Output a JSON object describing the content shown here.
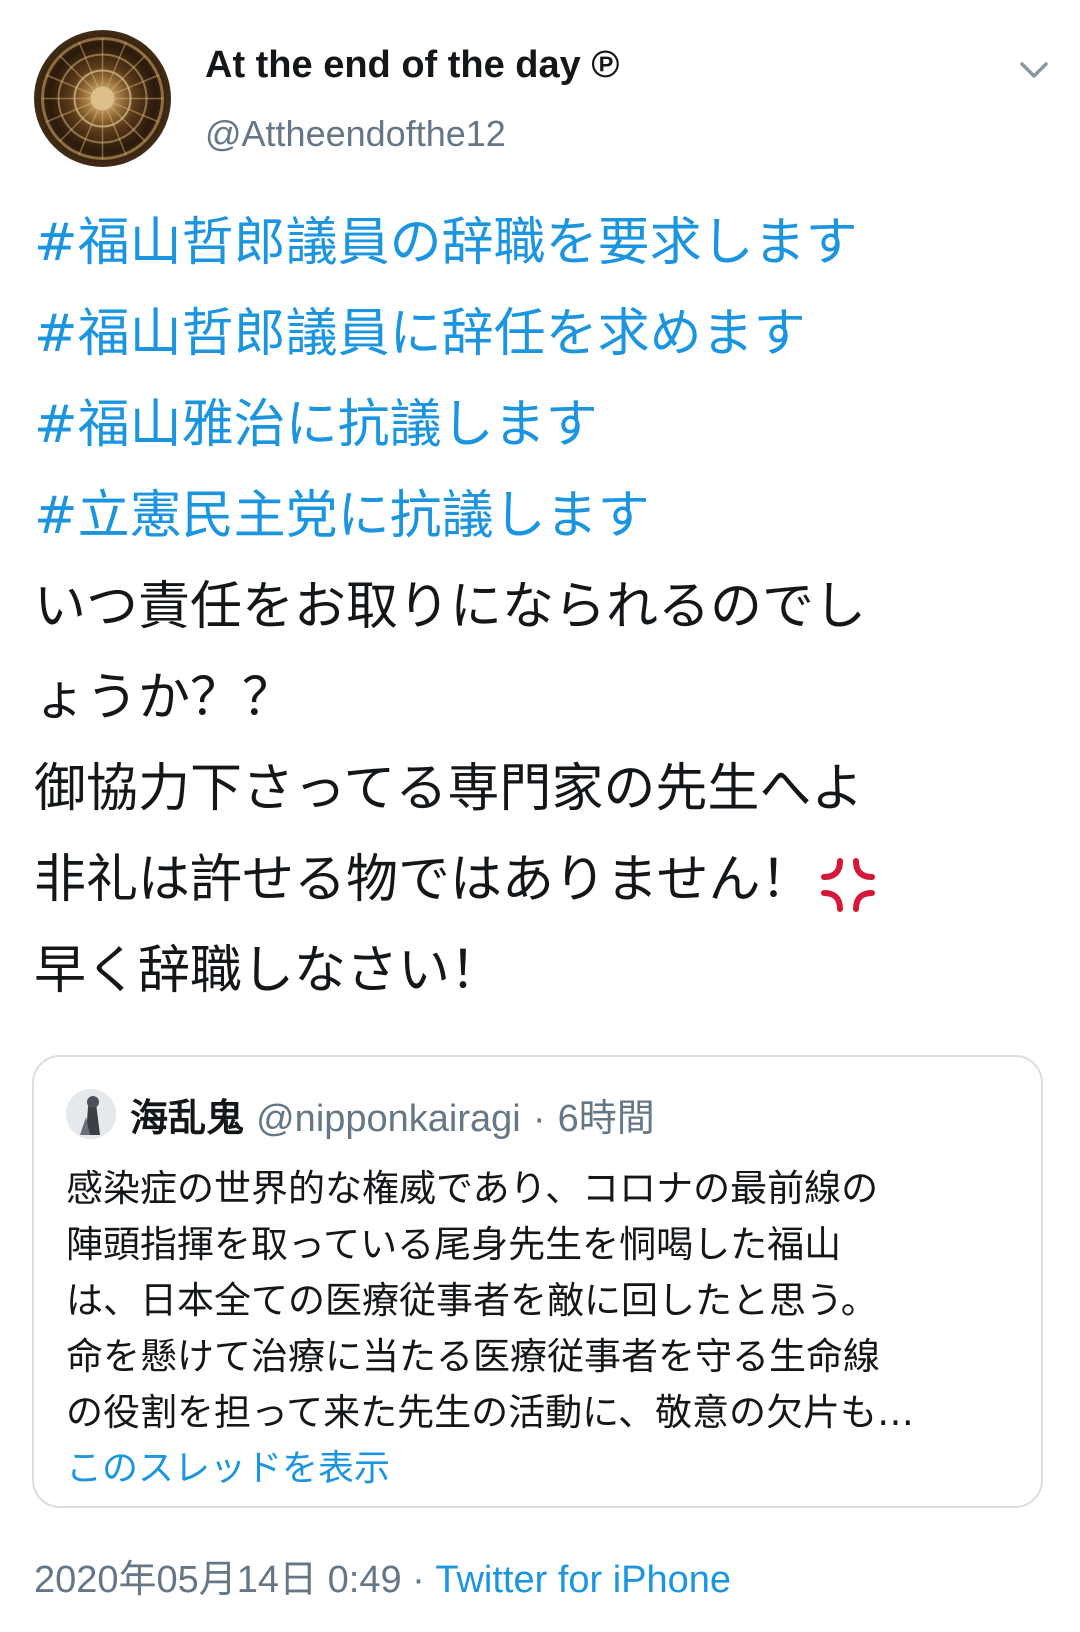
{
  "author": {
    "display_name": "At the end of the day ℗",
    "handle": "@Attheendofthe12"
  },
  "tweet": {
    "lines": [
      {
        "text": "#福山哲郎議員の辞職を要求します",
        "kind": "hashtag"
      },
      {
        "text": "#福山哲郎議員に辞任を求めます",
        "kind": "hashtag"
      },
      {
        "text": "#福山雅治に抗議します",
        "kind": "hashtag"
      },
      {
        "text": "#立憲民主党に抗議します",
        "kind": "hashtag"
      },
      {
        "text": "いつ責任をお取りになられるのでし",
        "kind": "text"
      },
      {
        "text": "ょうか？？",
        "kind": "text"
      },
      {
        "text": "御協力下さってる専門家の先生へよ",
        "kind": "text"
      },
      {
        "text": "非礼は許せる物ではありません！",
        "kind": "text",
        "emoji": "anger-symbol-icon"
      },
      {
        "text": "早く辞職しなさい！",
        "kind": "text"
      }
    ]
  },
  "quoted_tweet": {
    "name": "海乱鬼",
    "handle": "@nipponkairagi",
    "separator": "·",
    "time": "6時間",
    "body_lines": [
      "感染症の世界的な権威であり、コロナの最前線の",
      "陣頭指揮を取っている尾身先生を恫喝した福山",
      "は、日本全ての医療従事者を敵に回したと思う。",
      "命を懸けて治療に当たる医療従事者を守る生命線",
      "の役割を担って来た先生の活動に、敬意の欠片も…"
    ],
    "show_thread_label": "このスレッドを表示"
  },
  "meta": {
    "timestamp": "2020年05月14日 0:49",
    "separator": "·",
    "source": "Twitter for iPhone"
  },
  "colors": {
    "link": "#1b95e0",
    "text": "#14171a",
    "secondary": "#657786",
    "border": "#d9dee2",
    "anger_emoji": "#d4173a"
  },
  "icons": {
    "menu": "chevron-down-icon",
    "emoji": "anger-symbol-icon"
  }
}
